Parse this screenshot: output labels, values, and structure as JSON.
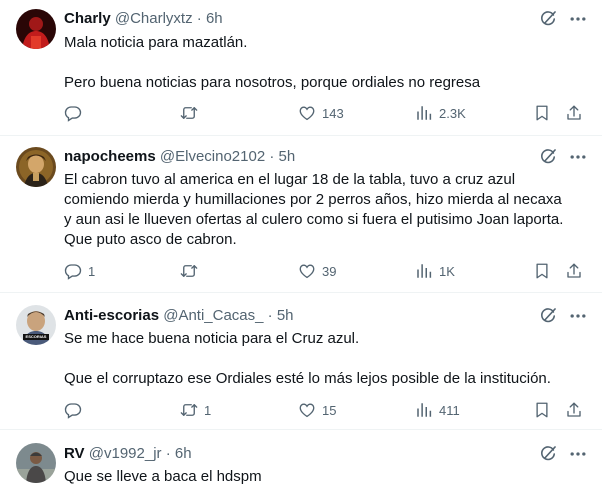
{
  "tweets": [
    {
      "name": "Charly",
      "handle": "@Charlyxtz",
      "dot": "·",
      "time": "6h",
      "lines": [
        "Mala noticia para mazatlán.",
        "",
        "Pero buena noticias para nosotros, porque ordiales no regresa"
      ],
      "replies": "",
      "retweets": "",
      "likes": "143",
      "views": "2.3K"
    },
    {
      "name": "napocheems",
      "handle": "@Elvecino2102",
      "dot": "·",
      "time": "5h",
      "lines": [
        "El cabron tuvo al america en el lugar 18 de la tabla, tuvo a cruz azul",
        "comiendo mierda y humillaciones por 2 perros años, hizo mierda al necaxa",
        "y aun asi le llueven ofertas al culero como si fuera el putisimo Joan laporta.",
        "Que puto asco de cabron."
      ],
      "replies": "1",
      "retweets": "",
      "likes": "39",
      "views": "1K"
    },
    {
      "name": "Anti-escorias",
      "handle": "@Anti_Cacas_",
      "dot": "·",
      "time": "5h",
      "lines": [
        "Se me hace buena noticia para el Cruz azul.",
        "",
        "Que el corruptazo ese Ordiales esté lo más lejos posible de la institución."
      ],
      "replies": "",
      "retweets": "1",
      "likes": "15",
      "views": "411",
      "avatar_badge": "ESCORIAS"
    },
    {
      "name": "RV",
      "handle": "@v1992_jr",
      "dot": "·",
      "time": "6h",
      "lines": [
        "Que se lleve a baca el hdspm"
      ]
    }
  ],
  "icons": {
    "reply": "reply-icon",
    "retweet": "retweet-icon",
    "like": "like-icon",
    "views": "views-icon",
    "bookmark": "bookmark-icon",
    "share": "share-icon",
    "grok": "grok-icon",
    "more": "more-icon"
  },
  "colors": {
    "text": "#0f1419",
    "secondary": "#536471",
    "divider": "#eff3f4"
  }
}
